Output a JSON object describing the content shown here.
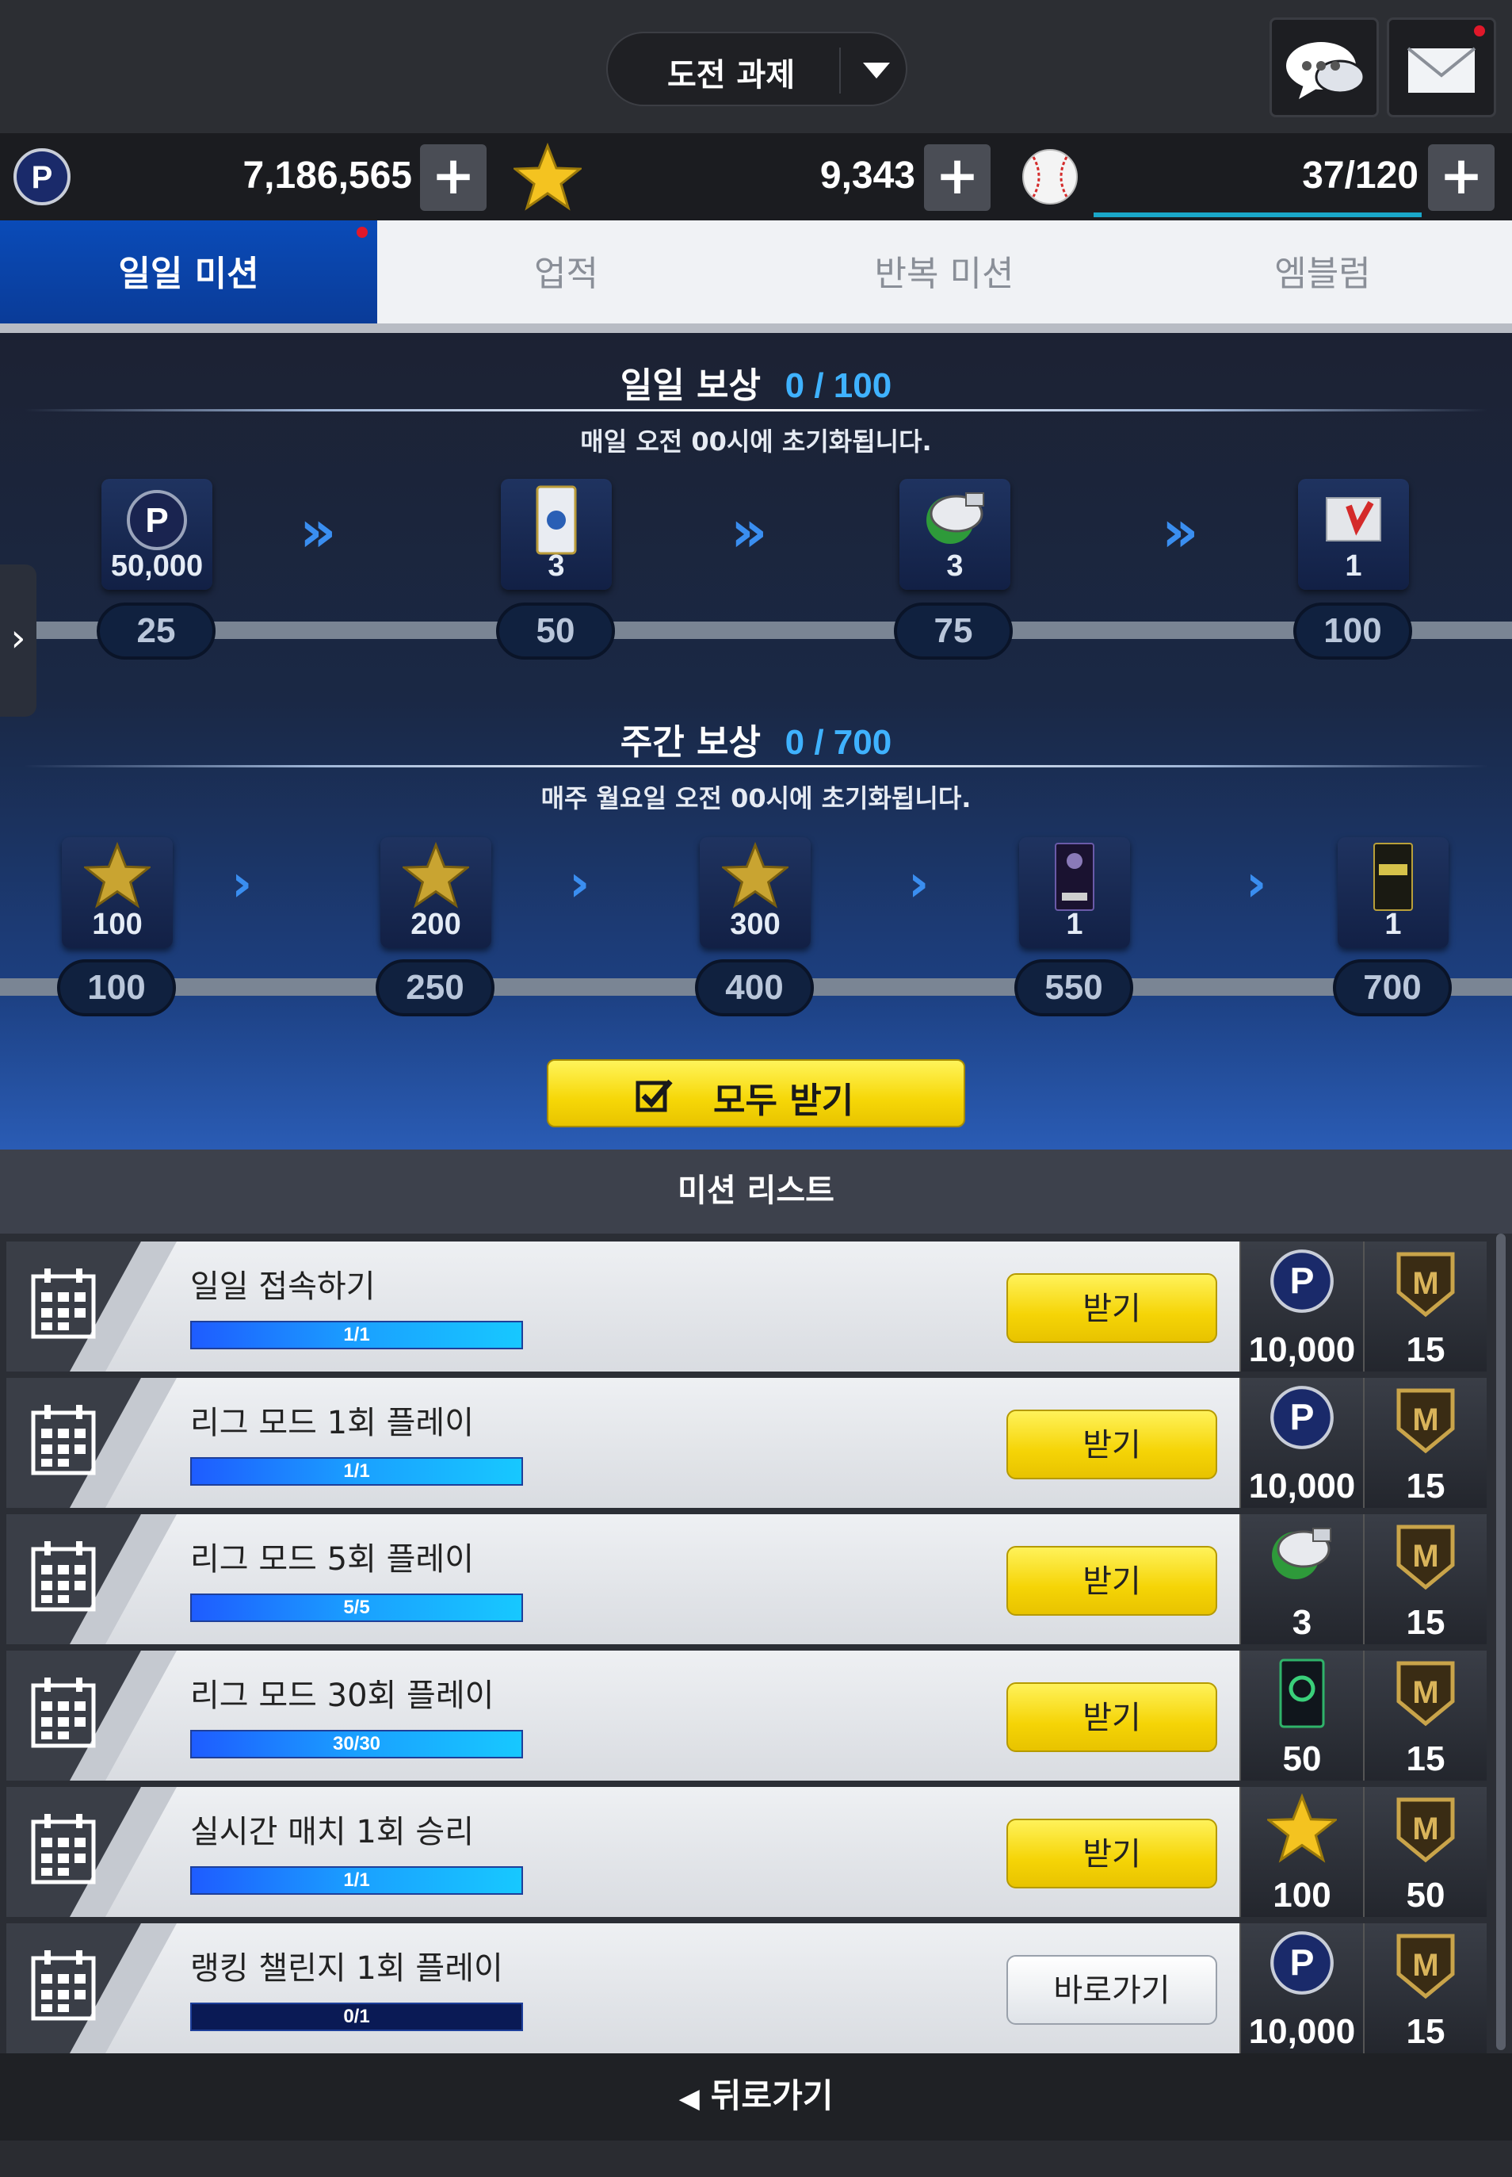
{
  "header": {
    "dropdown_label": "도전 과제",
    "chat_icon": "chat-bubble-icon",
    "mail_icon": "mail-icon"
  },
  "currency": {
    "points": "7,186,565",
    "stars": "9,343",
    "energy": "37/120",
    "plus": "+"
  },
  "tabs": [
    {
      "label": "일일 미션",
      "active": true
    },
    {
      "label": "업적"
    },
    {
      "label": "반복 미션"
    },
    {
      "label": "엠블럼"
    }
  ],
  "daily": {
    "title": "일일 보상",
    "progress": "0 / 100",
    "subtitle": "매일 오전 00시에 초기화됩니다.",
    "rewards": [
      {
        "icon": "p-coin-icon",
        "qty": "50,000",
        "goal": "25"
      },
      {
        "icon": "card-pack-icon",
        "qty": "3",
        "goal": "50"
      },
      {
        "icon": "whistle-icon",
        "qty": "3",
        "goal": "75"
      },
      {
        "icon": "gift-box-icon",
        "qty": "1",
        "goal": "100"
      }
    ]
  },
  "weekly": {
    "title": "주간 보상",
    "progress": "0 / 700",
    "subtitle": "매주 월요일 오전 00시에 초기화됩니다.",
    "rewards": [
      {
        "icon": "star-icon",
        "qty": "100",
        "goal": "100"
      },
      {
        "icon": "star-icon",
        "qty": "200",
        "goal": "250"
      },
      {
        "icon": "star-icon",
        "qty": "300",
        "goal": "400"
      },
      {
        "icon": "player-card-icon",
        "qty": "1",
        "goal": "550"
      },
      {
        "icon": "impact-card-icon",
        "qty": "1",
        "goal": "700"
      }
    ]
  },
  "claim_all_label": "모두 받기",
  "list_title": "미션 리스트",
  "missions": [
    {
      "name": "일일 접속하기",
      "progress_text": "1/1",
      "progress": 1.0,
      "button": "받기",
      "button_style": "yellow",
      "reward1_icon": "p-coin-icon",
      "reward1": "10,000",
      "reward2_icon": "m-badge-icon",
      "reward2": "15"
    },
    {
      "name": "리그 모드 1회 플레이",
      "progress_text": "1/1",
      "progress": 1.0,
      "button": "받기",
      "button_style": "yellow",
      "reward1_icon": "p-coin-icon",
      "reward1": "10,000",
      "reward2_icon": "m-badge-icon",
      "reward2": "15"
    },
    {
      "name": "리그 모드 5회 플레이",
      "progress_text": "5/5",
      "progress": 1.0,
      "button": "받기",
      "button_style": "yellow",
      "reward1_icon": "whistle-icon",
      "reward1": "3",
      "reward2_icon": "m-badge-icon",
      "reward2": "15"
    },
    {
      "name": "리그 모드 30회 플레이",
      "progress_text": "30/30",
      "progress": 1.0,
      "button": "받기",
      "button_style": "yellow",
      "reward1_icon": "training-card-icon",
      "reward1": "50",
      "reward2_icon": "m-badge-icon",
      "reward2": "15"
    },
    {
      "name": "실시간 매치 1회 승리",
      "progress_text": "1/1",
      "progress": 1.0,
      "button": "받기",
      "button_style": "yellow",
      "reward1_icon": "star-icon",
      "reward1": "100",
      "reward2_icon": "m-badge-icon",
      "reward2": "50"
    },
    {
      "name": "랭킹 챌린지 1회 플레이",
      "progress_text": "0/1",
      "progress": 0.0,
      "button": "바로가기",
      "button_style": "white",
      "reward1_icon": "p-coin-icon",
      "reward1": "10,000",
      "reward2_icon": "m-badge-icon",
      "reward2": "15"
    }
  ],
  "back_label": "뒤로가기",
  "colors": {
    "accent_blue": "#3fb2ff",
    "tab_active": "#0a4bb8",
    "button_yellow": "#f5d406"
  }
}
